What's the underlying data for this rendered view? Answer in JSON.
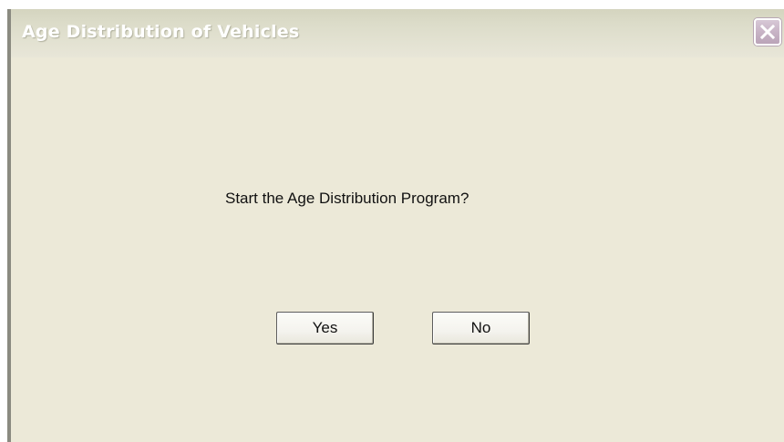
{
  "window": {
    "title": "Age Distribution of Vehicles",
    "close_icon": "close-icon"
  },
  "dialog": {
    "message": "Start the Age Distribution Program?",
    "yes_label": "Yes",
    "no_label": "No"
  },
  "colors": {
    "dialog_background": "#ece9d8",
    "title_text": "#ffffff",
    "close_button": "#c8b4c6"
  }
}
